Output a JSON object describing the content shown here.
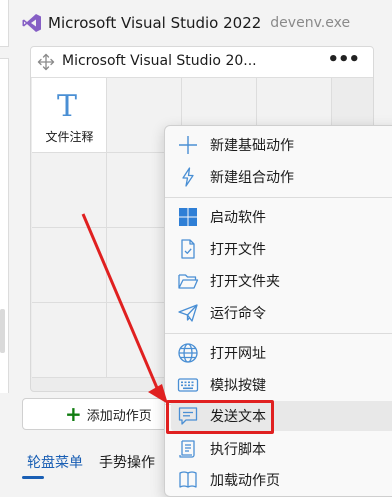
{
  "window": {
    "title": "Microsoft Visual Studio 2022",
    "process": "devenv.exe"
  },
  "card": {
    "title": "Microsoft Visual Studio 20...",
    "more": "•••",
    "cell": {
      "icon_glyph": "T",
      "label": "文件注释"
    }
  },
  "add_page": {
    "plus": "+",
    "label": "添加动作页"
  },
  "tabs": {
    "active": "轮盘菜单",
    "inactive": "手势操作"
  },
  "context_menu": {
    "items": [
      {
        "label": "新建基础动作",
        "icon": "plus-icon"
      },
      {
        "label": "新建组合动作",
        "icon": "lightning-icon"
      },
      {
        "label": "启动软件",
        "icon": "windows-logo-icon"
      },
      {
        "label": "打开文件",
        "icon": "document-check-icon"
      },
      {
        "label": "打开文件夹",
        "icon": "folder-icon"
      },
      {
        "label": "运行命令",
        "icon": "send-icon"
      },
      {
        "label": "打开网址",
        "icon": "globe-icon"
      },
      {
        "label": "模拟按键",
        "icon": "keyboard-icon"
      },
      {
        "label": "发送文本",
        "icon": "chat-bubble-icon"
      },
      {
        "label": "执行脚本",
        "icon": "script-icon"
      },
      {
        "label": "加载动作页",
        "icon": "book-icon"
      }
    ]
  },
  "colors": {
    "accent": "#1a5fb4",
    "icon_blue": "#4a8fd4",
    "highlight_red": "#e02020",
    "add_green": "#107c10"
  }
}
